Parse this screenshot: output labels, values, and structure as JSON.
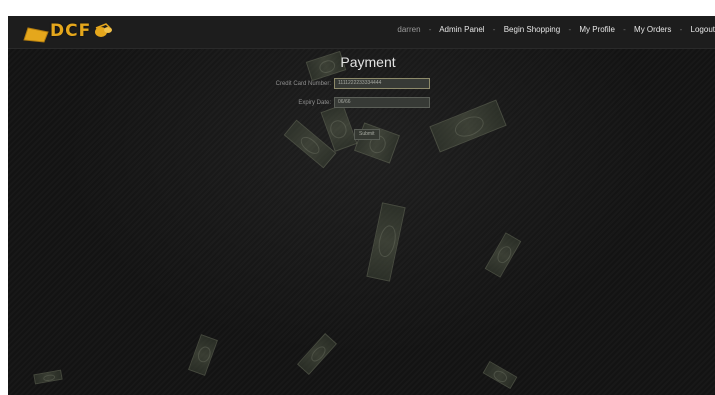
{
  "brand": {
    "logo_text": "DCF",
    "accent_color": "#e5a71c",
    "icon": "money-bag-icon"
  },
  "nav": {
    "user": "darren",
    "separator": "-",
    "links": [
      {
        "label": "Admin Panel"
      },
      {
        "label": "Begin Shopping"
      },
      {
        "label": "My Profile"
      },
      {
        "label": "My Orders"
      },
      {
        "label": "Logout"
      }
    ]
  },
  "payment": {
    "title": "Payment",
    "card_label": "Credit Card Number:",
    "card_value": "1111222233334444",
    "expiry_label": "Expiry Date:",
    "expiry_value": "06/66",
    "submit_label": "Submit"
  }
}
